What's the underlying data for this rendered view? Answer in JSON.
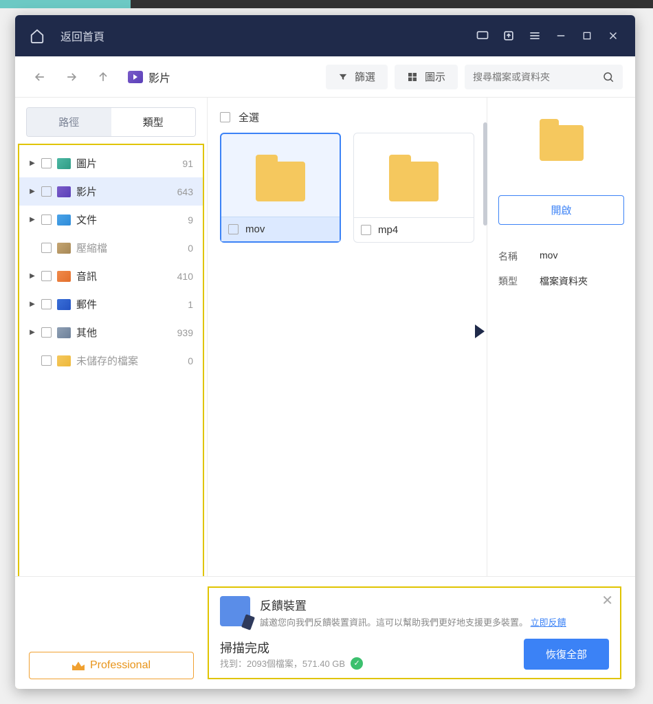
{
  "titlebar": {
    "home_label": "返回首頁"
  },
  "toolbar": {
    "breadcrumb": "影片",
    "filter_label": "篩選",
    "view_label": "圖示",
    "search_placeholder": "搜尋檔案或資料夾"
  },
  "sidebar": {
    "tab_path": "路徑",
    "tab_type": "類型",
    "categories": [
      {
        "label": "圖片",
        "count": "91",
        "icon": "icon-img",
        "dim": false,
        "arrow": true
      },
      {
        "label": "影片",
        "count": "643",
        "icon": "icon-vid",
        "dim": false,
        "arrow": true,
        "selected": true
      },
      {
        "label": "文件",
        "count": "9",
        "icon": "icon-doc",
        "dim": false,
        "arrow": true
      },
      {
        "label": "壓縮檔",
        "count": "0",
        "icon": "icon-zip",
        "dim": true,
        "arrow": false
      },
      {
        "label": "音訊",
        "count": "410",
        "icon": "icon-aud",
        "dim": false,
        "arrow": true
      },
      {
        "label": "郵件",
        "count": "1",
        "icon": "icon-mail",
        "dim": false,
        "arrow": true
      },
      {
        "label": "其他",
        "count": "939",
        "icon": "icon-other",
        "dim": false,
        "arrow": true
      },
      {
        "label": "未儲存的檔案",
        "count": "0",
        "icon": "icon-unsave",
        "dim": true,
        "arrow": false
      }
    ]
  },
  "main": {
    "select_all": "全選",
    "folders": [
      {
        "name": "mov",
        "selected": true
      },
      {
        "name": "mp4",
        "selected": false
      }
    ]
  },
  "detail": {
    "open_label": "開啟",
    "name_key": "名稱",
    "name_val": "mov",
    "type_key": "類型",
    "type_val": "檔案資料夾"
  },
  "bottom": {
    "pro_label": "Professional",
    "feedback_title": "反饋裝置",
    "feedback_desc": "誠邀您向我們反饋裝置資訊。這可以幫助我們更好地支援更多裝置。",
    "feedback_link": "立即反饋",
    "scan_done": "掃描完成",
    "scan_sub": "找到：2093個檔案，571.40 GB",
    "recover_label": "恢復全部"
  }
}
